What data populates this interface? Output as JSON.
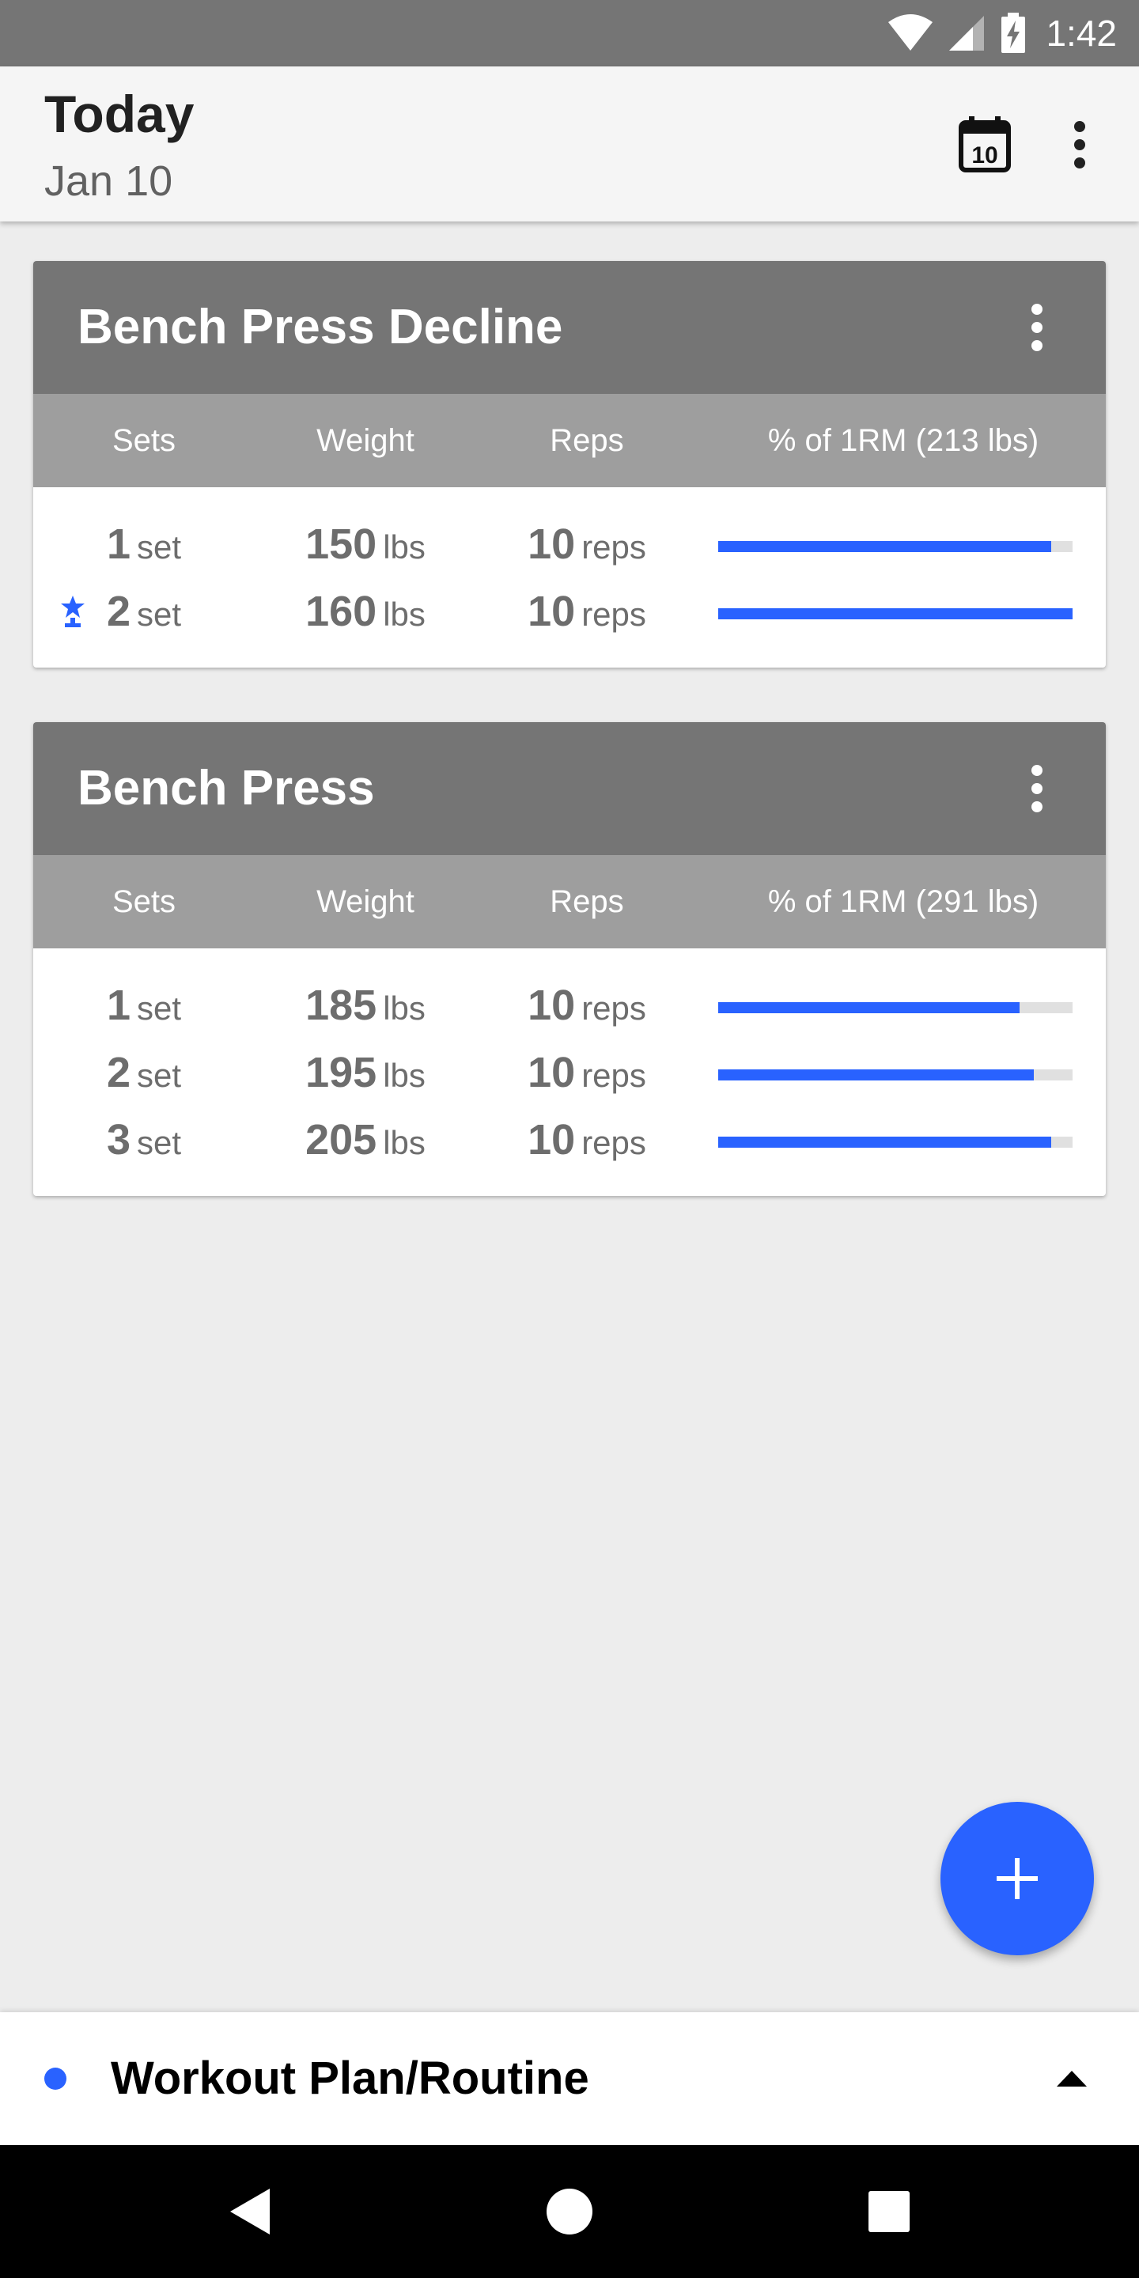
{
  "status_bar": {
    "time": "1:42"
  },
  "app_bar": {
    "title": "Today",
    "subtitle": "Jan 10",
    "calendar_day": "10"
  },
  "columns": {
    "sets": "Sets",
    "weight": "Weight",
    "reps": "Reps"
  },
  "exercises": [
    {
      "name": "Bench Press Decline",
      "pct_header": "% of 1RM (213 lbs)",
      "sets": [
        {
          "set": "1",
          "set_unit": "set",
          "weight": "150",
          "weight_unit": "lbs",
          "reps": "10",
          "reps_unit": "reps",
          "pct_of_1rm": 0.94,
          "personal_record": false
        },
        {
          "set": "2",
          "set_unit": "set",
          "weight": "160",
          "weight_unit": "lbs",
          "reps": "10",
          "reps_unit": "reps",
          "pct_of_1rm": 1.0,
          "personal_record": true
        }
      ]
    },
    {
      "name": "Bench Press",
      "pct_header": "% of 1RM (291 lbs)",
      "sets": [
        {
          "set": "1",
          "set_unit": "set",
          "weight": "185",
          "weight_unit": "lbs",
          "reps": "10",
          "reps_unit": "reps",
          "pct_of_1rm": 0.85,
          "personal_record": false
        },
        {
          "set": "2",
          "set_unit": "set",
          "weight": "195",
          "weight_unit": "lbs",
          "reps": "10",
          "reps_unit": "reps",
          "pct_of_1rm": 0.89,
          "personal_record": false
        },
        {
          "set": "3",
          "set_unit": "set",
          "weight": "205",
          "weight_unit": "lbs",
          "reps": "10",
          "reps_unit": "reps",
          "pct_of_1rm": 0.94,
          "personal_record": false
        }
      ]
    }
  ],
  "bottom_sheet": {
    "label": "Workout Plan/Routine"
  },
  "icons": {
    "calendar": "calendar-icon",
    "overflow": "more-vert-icon",
    "add": "add-icon",
    "personal_record": "trophy-star-icon",
    "expand": "arrow-up-icon"
  },
  "colors": {
    "accent": "#2962ff",
    "card_header": "#757575",
    "column_header": "#9e9e9e",
    "background": "#ededed"
  }
}
